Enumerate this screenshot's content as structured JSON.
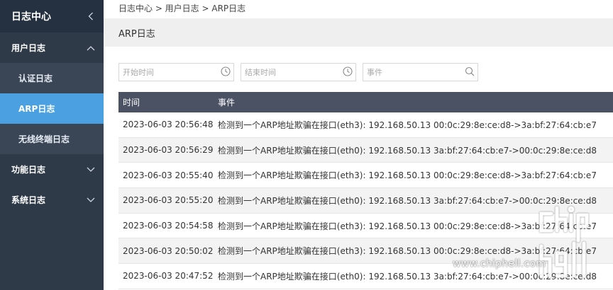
{
  "sidebar": {
    "title": "日志中心",
    "groups": [
      {
        "label": "用户日志",
        "expanded": true
      },
      {
        "label": "功能日志",
        "expanded": false
      },
      {
        "label": "系统日志",
        "expanded": false
      }
    ],
    "subitems": [
      "认证日志",
      "ARP日志",
      "无线终端日志"
    ],
    "active_subitem": "ARP日志"
  },
  "breadcrumb": "日志中心 > 用户日志 > ARP日志",
  "page_title": "ARP日志",
  "filters": {
    "start_placeholder": "开始时间",
    "end_placeholder": "结束时间",
    "event_placeholder": "事件"
  },
  "table": {
    "columns": [
      "时间",
      "事件"
    ],
    "rows": [
      {
        "time": "2023-06-03 20:56:48",
        "event": "检测到一个ARP地址欺骗在接口(eth3): 192.168.50.13 00:0c:29:8e:ce:d8->3a:bf:27:64:cb:e7"
      },
      {
        "time": "2023-06-03 20:56:29",
        "event": "检测到一个ARP地址欺骗在接口(eth0): 192.168.50.13 3a:bf:27:64:cb:e7->00:0c:29:8e:ce:d8"
      },
      {
        "time": "2023-06-03 20:55:40",
        "event": "检测到一个ARP地址欺骗在接口(eth3): 192.168.50.13 00:0c:29:8e:ce:d8->3a:bf:27:64:cb:e7"
      },
      {
        "time": "2023-06-03 20:55:20",
        "event": "检测到一个ARP地址欺骗在接口(eth0): 192.168.50.13 3a:bf:27:64:cb:e7->00:0c:29:8e:ce:d8"
      },
      {
        "time": "2023-06-03 20:54:58",
        "event": "检测到一个ARP地址欺骗在接口(eth3): 192.168.50.13 00:0c:29:8e:ce:d8->3a:bf:27:64:cb:e7"
      },
      {
        "time": "2023-06-03 20:50:02",
        "event": "检测到一个ARP地址欺骗在接口(eth3): 192.168.50.13 00:0c:29:8e:ce:d8->3a:bf:27:64:cb:e7"
      },
      {
        "time": "2023-06-03 20:47:52",
        "event": "检测到一个ARP地址欺骗在接口(eth0): 192.168.50.13 3a:bf:27:64:cb:e7->00:0c:29:8e:ce:d8"
      }
    ]
  },
  "watermark": {
    "text": "www.chiphell.com",
    "logo": "chip hell"
  },
  "colors": {
    "sidebar": "#2f3a49",
    "active": "#4aa0e0",
    "table_header": "#4a5264"
  },
  "icons": {
    "collapse": "chevron-left-icon",
    "expanded": "chevron-up-icon",
    "collapsed": "chevron-down-icon",
    "clock": "clock-icon",
    "search": "search-icon"
  }
}
